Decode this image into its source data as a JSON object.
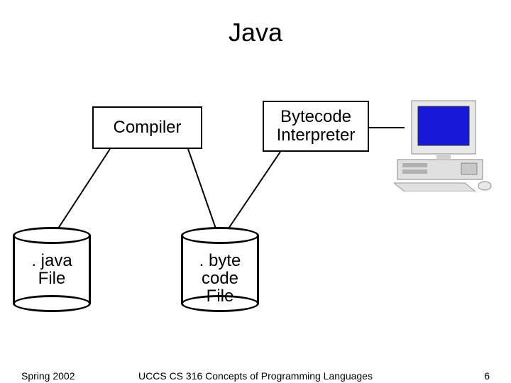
{
  "title": "Java",
  "boxes": {
    "compiler": "Compiler",
    "interpreter": "Bytecode Interpreter"
  },
  "cylinders": {
    "java": ". java\nFile",
    "byte": ". byte\ncode\nFile"
  },
  "footer": {
    "left": "Spring 2002",
    "center": "UCCS CS 316 Concepts of Programming Languages",
    "right": "6"
  }
}
